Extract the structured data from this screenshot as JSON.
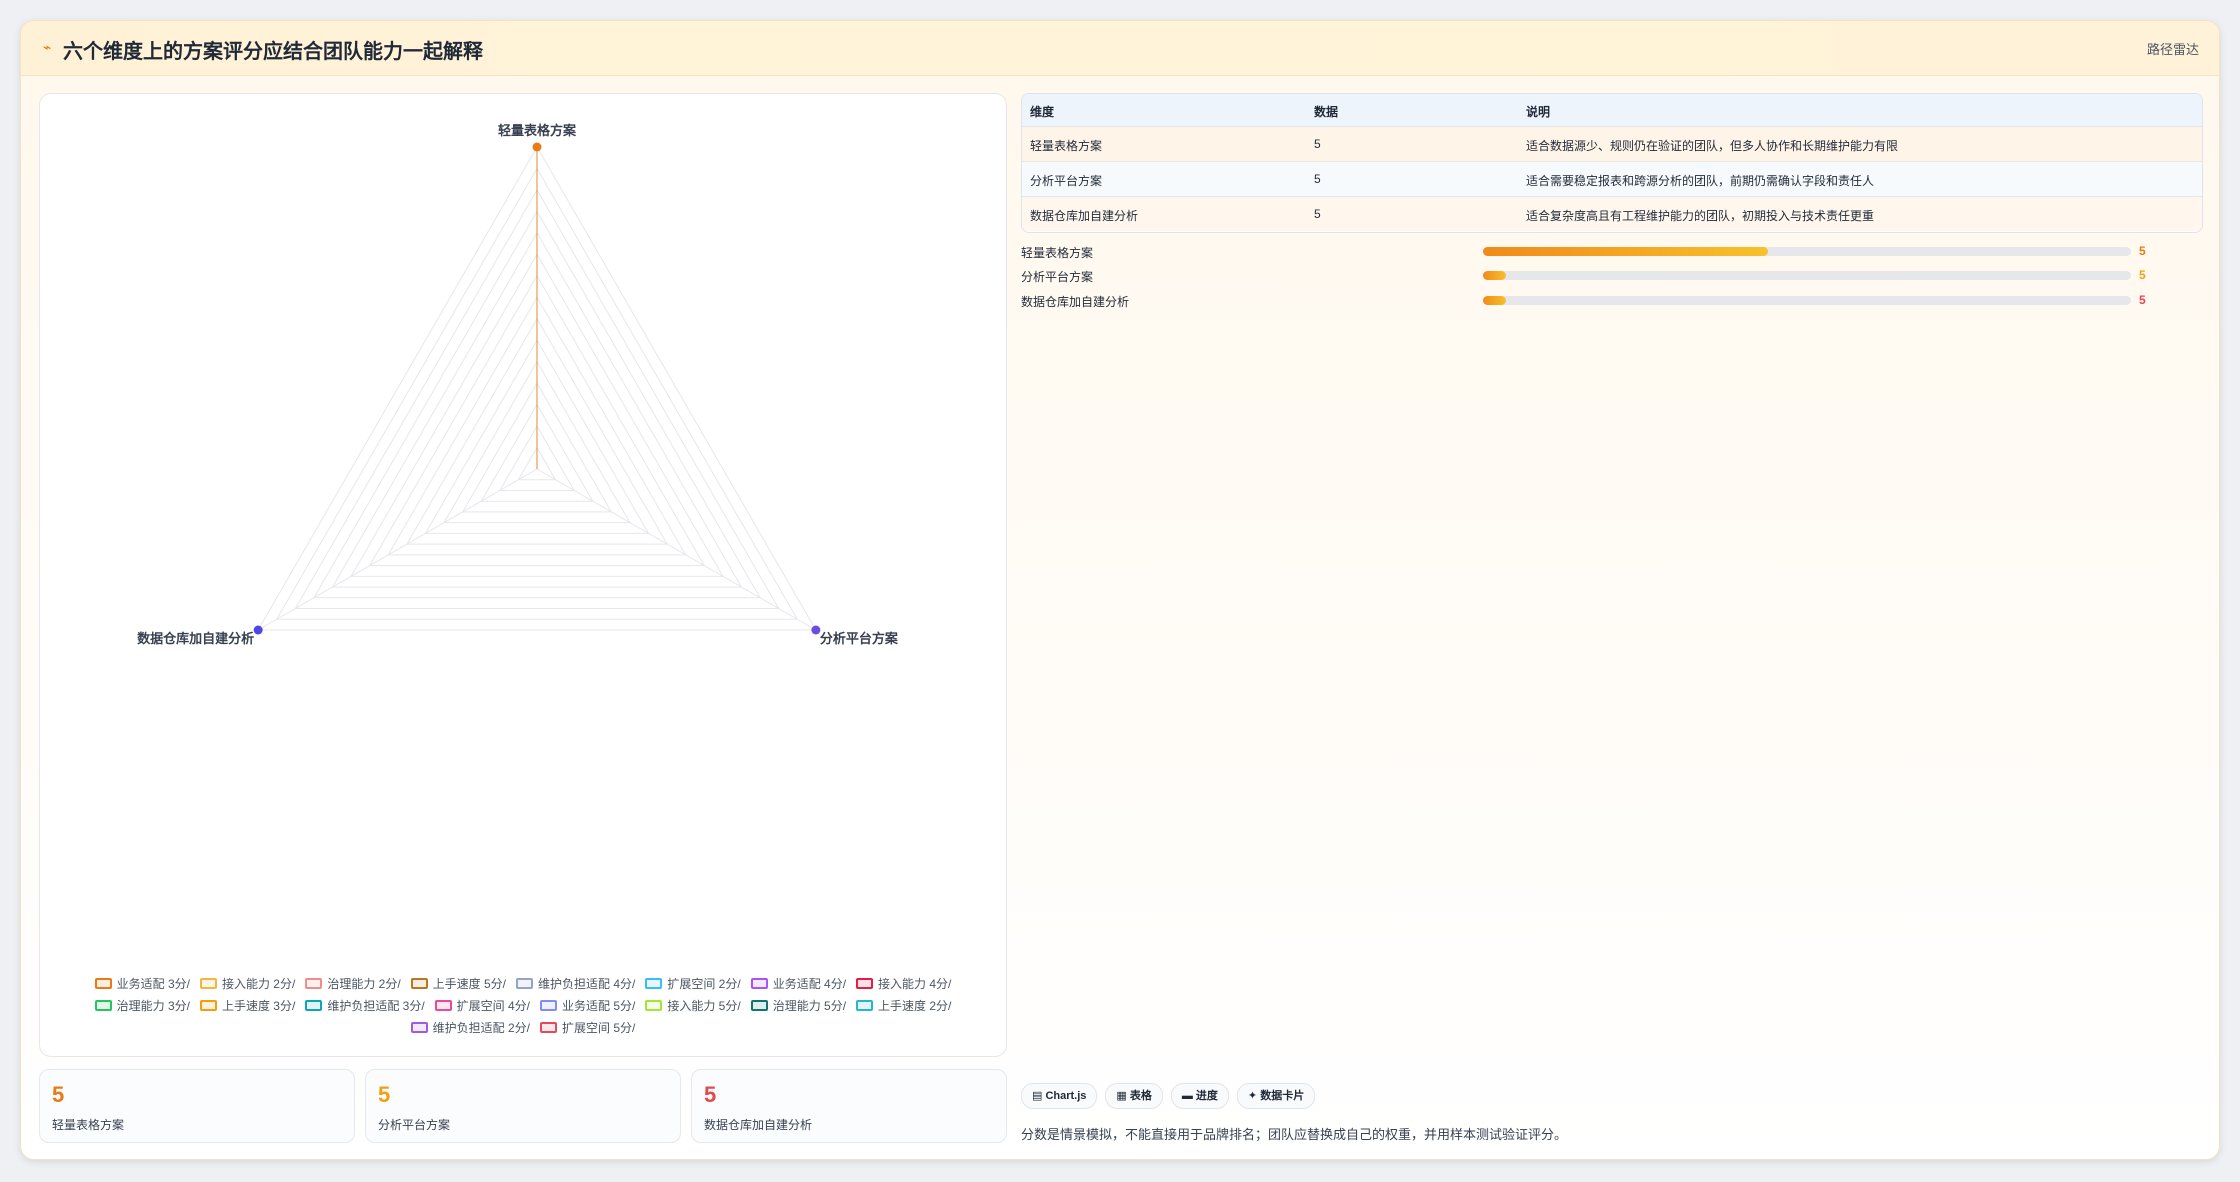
{
  "header": {
    "icon": "⌁",
    "title": "六个维度上的方案评分应结合团队能力一起解释",
    "tag": "路径雷达"
  },
  "chart_data": {
    "type": "radar",
    "categories": [
      "轻量表格方案",
      "分析平台方案",
      "数据仓库加自建分析"
    ],
    "rmax": 10,
    "series": [
      {
        "name": "业务适配 3分/",
        "color": "#e97a14",
        "values": [
          10,
          0,
          0
        ]
      },
      {
        "name": "接入能力 2分/",
        "color": "#f4b63c",
        "values": [
          0,
          0,
          0
        ]
      },
      {
        "name": "治理能力 2分/",
        "color": "#f28b8b",
        "values": [
          0,
          0,
          0
        ]
      },
      {
        "name": "上手速度 5分/",
        "color": "#b7791f",
        "values": [
          0,
          0,
          0
        ]
      },
      {
        "name": "维护负担适配 4分/",
        "color": "#94a3c8",
        "values": [
          0,
          0,
          0
        ]
      },
      {
        "name": "扩展空间 2分/",
        "color": "#38bdf8",
        "values": [
          0,
          0,
          0
        ]
      },
      {
        "name": "业务适配 4分/",
        "color": "#a855f7",
        "values": [
          0,
          0,
          0
        ]
      },
      {
        "name": "接入能力 4分/",
        "color": "#e11d48",
        "values": [
          0,
          0,
          0
        ]
      },
      {
        "name": "治理能力 3分/",
        "color": "#22c55e",
        "values": [
          0,
          0,
          0
        ]
      },
      {
        "name": "上手速度 3分/",
        "color": "#f59e0b",
        "values": [
          0,
          0,
          0
        ]
      },
      {
        "name": "维护负担适配 3分/",
        "color": "#0ea5b7",
        "values": [
          0,
          0,
          0
        ]
      },
      {
        "name": "扩展空间 4分/",
        "color": "#ec4899",
        "values": [
          0,
          0,
          0
        ]
      },
      {
        "name": "业务适配 5分/",
        "color": "#818cf8",
        "values": [
          0,
          0,
          0
        ]
      },
      {
        "name": "接入能力 5分/",
        "color": "#a3e635",
        "values": [
          0,
          0,
          0
        ]
      },
      {
        "name": "治理能力 5分/",
        "color": "#0f766e",
        "values": [
          0,
          0,
          0
        ]
      },
      {
        "name": "上手速度 2分/",
        "color": "#22b8cf",
        "values": [
          0,
          0,
          0
        ]
      },
      {
        "name": "维护负担适配 2分/",
        "color": "#9b5de5",
        "values": [
          0,
          0,
          0
        ]
      },
      {
        "name": "扩展空间 5分/",
        "color": "#e5485d",
        "values": [
          0,
          0,
          0
        ]
      }
    ],
    "point_colors": [
      "#e97a14",
      "#6d4ce0",
      "#4f46e5"
    ]
  },
  "kpis": [
    {
      "value": "5",
      "label": "轻量表格方案",
      "color": "#e97a14"
    },
    {
      "value": "5",
      "label": "分析平台方案",
      "color": "#f0a012"
    },
    {
      "value": "5",
      "label": "数据仓库加自建分析",
      "color": "#e5484d"
    }
  ],
  "table": {
    "headers": [
      "维度",
      "数据",
      "说明"
    ],
    "rows": [
      [
        "轻量表格方案",
        "5",
        "适合数据源少、规则仍在验证的团队，但多人协作和长期维护能力有限"
      ],
      [
        "分析平台方案",
        "5",
        "适合需要稳定报表和跨源分析的团队，前期仍需确认字段和责任人"
      ],
      [
        "数据仓库加自建分析",
        "5",
        "适合复杂度高且有工程维护能力的团队，初期投入与技术责任更重"
      ]
    ]
  },
  "progress": [
    {
      "label": "轻量表格方案",
      "value": "5",
      "fraction": 0.44
    },
    {
      "label": "分析平台方案",
      "value": "5",
      "fraction": 0.035
    },
    {
      "label": "数据仓库加自建分析",
      "value": "5",
      "fraction": 0.035
    }
  ],
  "chips": [
    "▤ Chart.js",
    "▦ 表格",
    "▬ 进度",
    "✦ 数据卡片"
  ],
  "note": "分数是情景模拟，不能直接用于品牌排名；团队应替换成自己的权重，并用样本测试验证评分。"
}
